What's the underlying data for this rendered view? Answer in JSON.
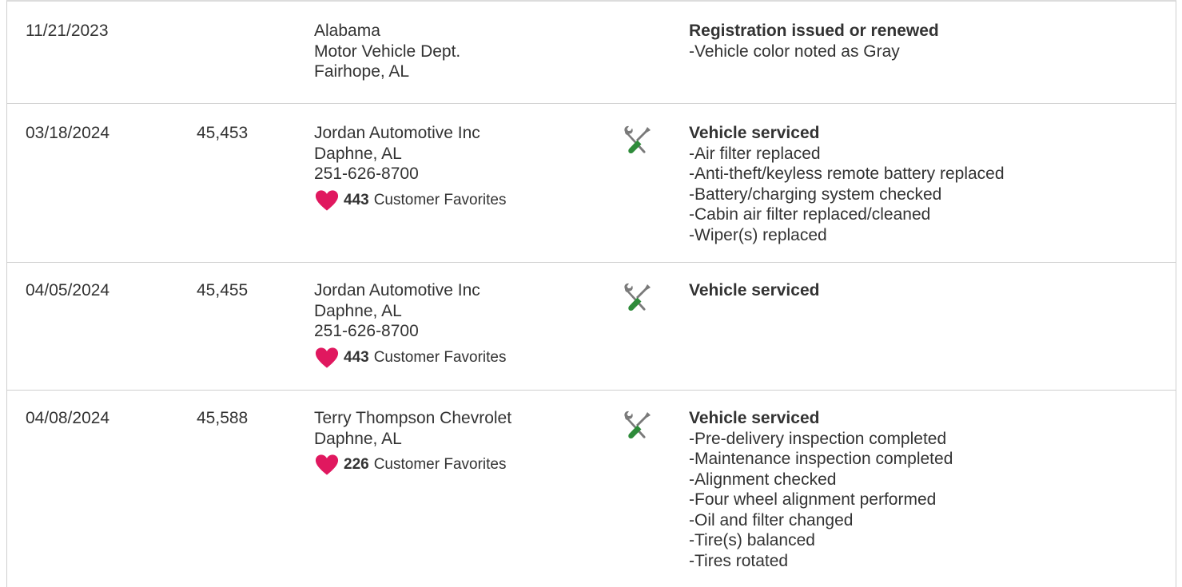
{
  "records": [
    {
      "date": "11/21/2023",
      "mileage": "",
      "source": [
        "Alabama",
        "Motor Vehicle Dept.",
        "Fairhope, AL"
      ],
      "favorites": null,
      "service_icon": null,
      "title": "Registration issued or renewed",
      "comments": [
        "Vehicle color noted as Gray"
      ]
    },
    {
      "date": "03/18/2024",
      "mileage": "45,453",
      "source": [
        "Jordan Automotive Inc",
        "Daphne, AL",
        "251-626-8700"
      ],
      "favorites": {
        "count": "443",
        "label": "Customer Favorites"
      },
      "service_icon": "wrench-screwdriver-icon",
      "title": "Vehicle serviced",
      "comments": [
        "Air filter replaced",
        "Anti-theft/keyless remote battery replaced",
        "Battery/charging system checked",
        "Cabin air filter replaced/cleaned",
        "Wiper(s) replaced"
      ]
    },
    {
      "date": "04/05/2024",
      "mileage": "45,455",
      "source": [
        "Jordan Automotive Inc",
        "Daphne, AL",
        "251-626-8700"
      ],
      "favorites": {
        "count": "443",
        "label": "Customer Favorites"
      },
      "service_icon": "wrench-screwdriver-icon",
      "title": "Vehicle serviced",
      "comments": []
    },
    {
      "date": "04/08/2024",
      "mileage": "45,588",
      "source": [
        "Terry Thompson Chevrolet",
        "Daphne, AL"
      ],
      "favorites": {
        "count": "226",
        "label": "Customer Favorites"
      },
      "service_icon": "wrench-screwdriver-icon",
      "title": "Vehicle serviced",
      "comments": [
        "Pre-delivery inspection completed",
        "Maintenance inspection completed",
        "Alignment checked",
        "Four wheel alignment performed",
        "Oil and filter changed",
        "Tire(s) balanced",
        "Tires rotated"
      ]
    }
  ],
  "colors": {
    "heart": "#e0185f",
    "tool_gray": "#7a7a7a",
    "tool_green": "#2e8b3a",
    "divider": "#cfcfcf",
    "text": "#333333"
  }
}
